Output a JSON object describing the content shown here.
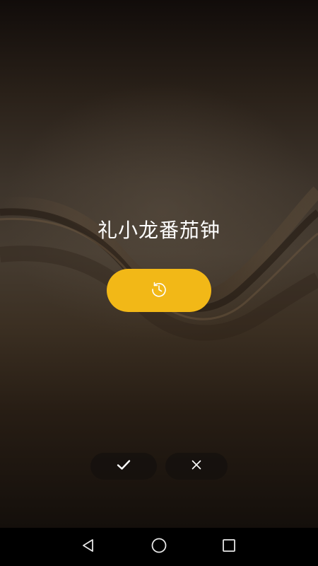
{
  "app": {
    "title": "礼小龙番茄钟"
  },
  "icons": {
    "snooze": "clock-restart-icon",
    "confirm": "check-icon",
    "dismiss": "close-icon",
    "nav_back": "triangle-back-icon",
    "nav_home": "circle-home-icon",
    "nav_recent": "square-recent-icon"
  },
  "colors": {
    "accent": "#f2b817",
    "icon": "#ffffff",
    "navbar": "#000000"
  }
}
